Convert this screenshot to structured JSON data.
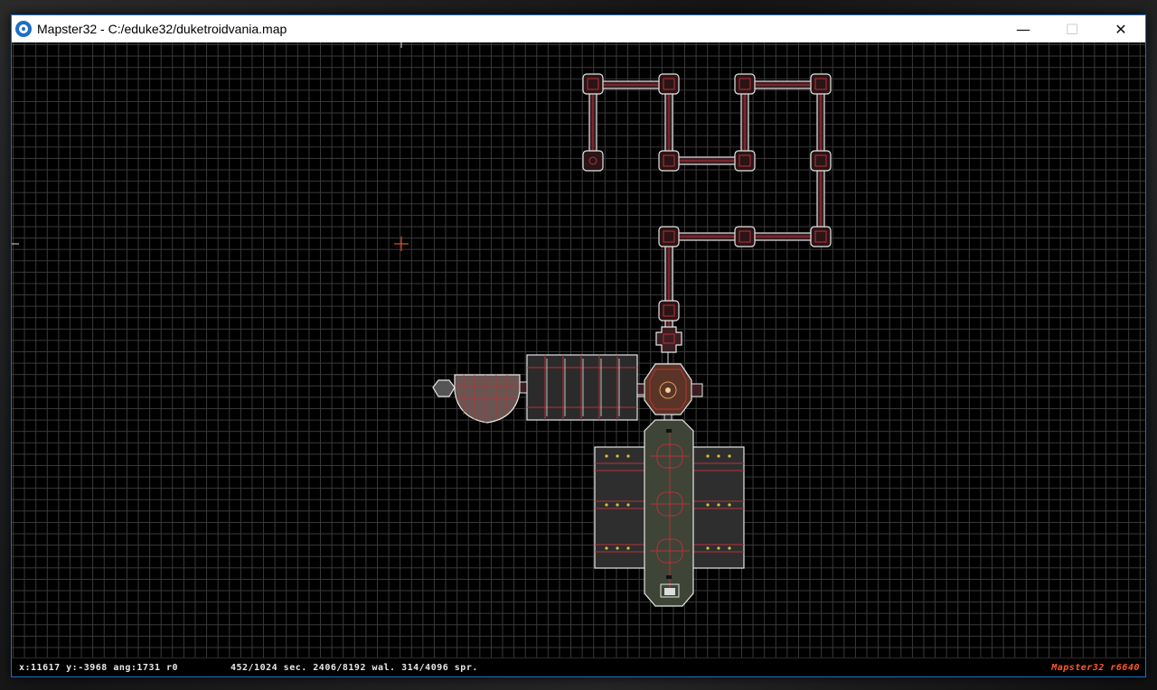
{
  "window": {
    "title": "Mapster32 - C:/eduke32/duketroidvania.map",
    "minimize_label": "—",
    "maximize_label": "☐",
    "close_label": "✕"
  },
  "status": {
    "coords": "x:11617 y:-3968 ang:1731 r0",
    "counts": "452/1024 sec. 2406/8192 wal. 314/4096 spr.",
    "brand": "Mapster32 r6640"
  },
  "colors": {
    "grid": "#3a3a3a",
    "wall_white": "#e6e6e6",
    "wall_red": "#b8323a",
    "cursor": "#d8542a",
    "status_brand": "#ff5a2a"
  },
  "icons": {
    "app": "mapster-radiation-icon",
    "cursor": "crosshair-icon"
  }
}
